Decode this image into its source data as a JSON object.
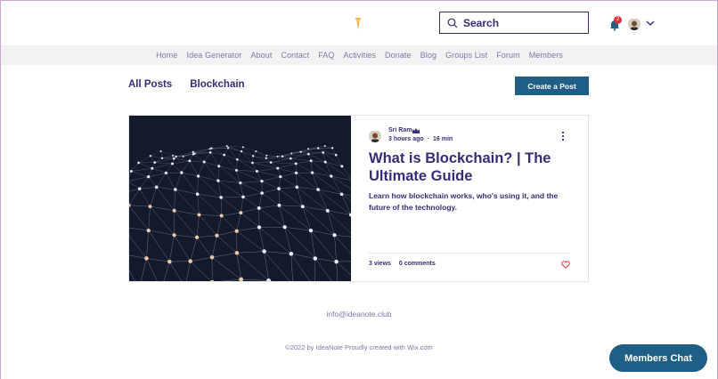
{
  "header": {
    "search_placeholder": "Search",
    "notification_count": "2"
  },
  "nav": {
    "items": [
      "Home",
      "Idea Generator",
      "About",
      "Contact",
      "FAQ",
      "Activities",
      "Donate",
      "Blog",
      "Groups List",
      "Forum",
      "Members"
    ]
  },
  "blog": {
    "tabs": [
      "All Posts",
      "Blockchain"
    ],
    "create_post_label": "Create a Post"
  },
  "post": {
    "author": "Sri Ram",
    "time_ago": "3 hours ago",
    "read_time": "16 min",
    "title": "What is Blockchain? | The Ultimate Guide",
    "excerpt": "Learn how blockchain works, who's using it, and the future of the technology.",
    "views": "3 views",
    "comments": "0 comments"
  },
  "footer": {
    "email": "info@ideanote.club",
    "copyright": "©2022 by IdeaNote Proudly created with Wix.com"
  },
  "chat": {
    "label": "Members Chat"
  },
  "colors": {
    "accent": "#1f5f86",
    "text": "#3b2a78",
    "nav_bg": "#f2f2f2",
    "like": "#e2313b"
  }
}
